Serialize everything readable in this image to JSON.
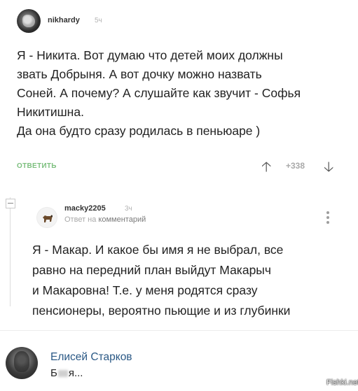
{
  "comment1": {
    "username": "nikhardy",
    "time": "5ч",
    "lines": [
      "Я - Никита. Вот думаю что детей моих должны",
      "звать Добрыня. А вот дочку можно назвать",
      "Соней. А почему? А слушайте как звучит - Софья",
      "Никитишна.",
      "Да она будто сразу родилась в пеньюаре )"
    ],
    "reply_label": "ОТВЕТИТЬ",
    "rating": "+338",
    "upvote_icon": "arrow-up-icon",
    "downvote_icon": "arrow-down-icon"
  },
  "comment2": {
    "username": "macky2205",
    "time": "3ч",
    "reply_prefix": "Ответ на ",
    "reply_link": "комментарий",
    "lines": [
      "Я - Макар. И какое бы имя я не выбрал, все",
      "равно на передний план выйдут Макарыч",
      "и Макаровна! Т.е. у меня родятся сразу",
      "пенсионеры, вероятно пьющие и из глубинки"
    ]
  },
  "comment3": {
    "name": "Елисей Старков",
    "text_start": "Б",
    "text_end": "я..."
  },
  "watermark": "Fishki.net",
  "colors": {
    "reply_green": "#7cbf7e",
    "vk_link_blue": "#2a5885",
    "muted_gray": "#a9a9a9"
  }
}
